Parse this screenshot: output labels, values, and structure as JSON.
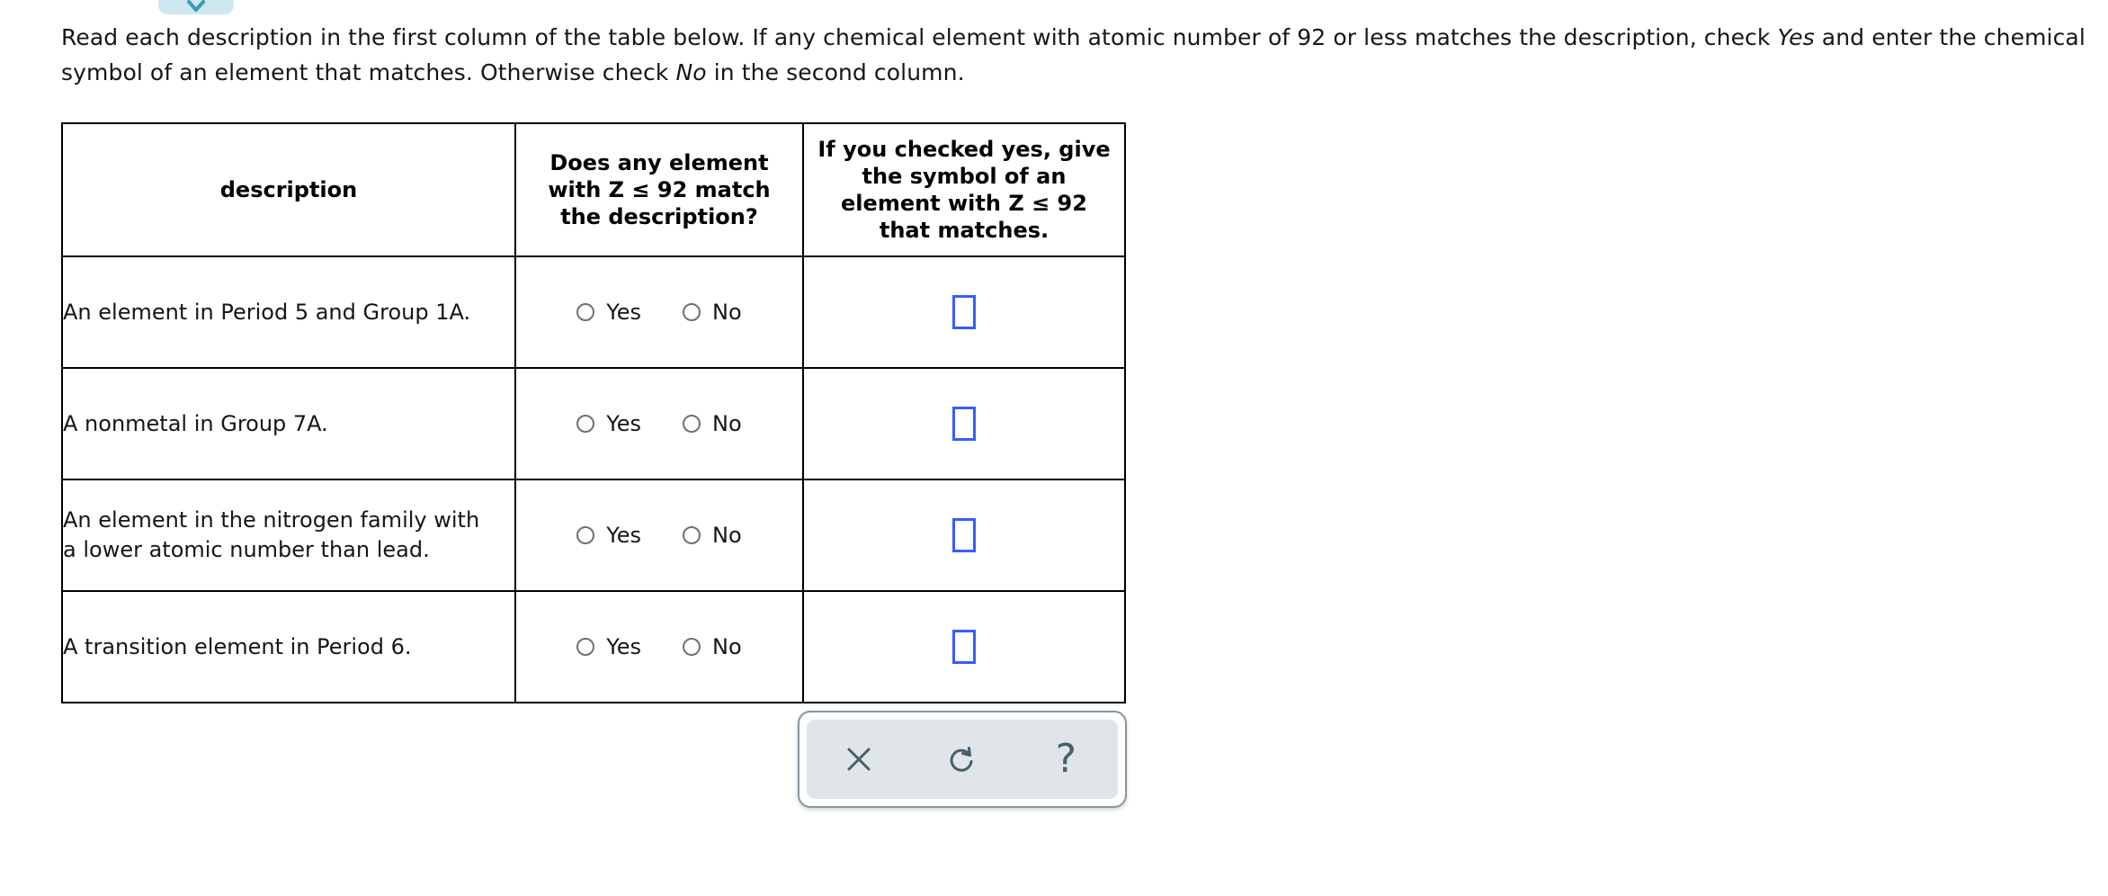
{
  "badge": {
    "icon": "chevron-down-icon",
    "glyph": "▼",
    "background_color": "#cfe8ef",
    "icon_color": "#3a9cb5"
  },
  "instructions": {
    "part1": "Read each description in the first column of the table below. If any chemical element with atomic number of 92 or less matches the description, check ",
    "emphasis1": "Yes",
    "part2": " and enter the chemical symbol of an element that matches. Otherwise check ",
    "emphasis2": "No",
    "part3": " in the second column."
  },
  "table": {
    "headers": [
      "description",
      "Does any element with Z ≤ 92 match the description?",
      "If you checked yes, give the symbol of an element with Z ≤ 92 that matches."
    ],
    "header_lines": {
      "col1": [
        "description"
      ],
      "col2": [
        "Does any element",
        "with Z ≤ 92 match",
        "the description?"
      ],
      "col3": [
        "If you checked yes, give",
        "the symbol of an",
        "element with Z ≤ 92",
        "that matches."
      ]
    },
    "radio_options": {
      "yes_label": "Yes",
      "no_label": "No"
    },
    "symbol_input": {
      "value": "",
      "placeholder": "",
      "border_color": "#3b5bfd"
    },
    "rows": [
      {
        "description": "An element in Period 5 and Group 1A.",
        "selected": "",
        "symbol": ""
      },
      {
        "description": "A nonmetal in Group 7A.",
        "selected": "",
        "symbol": ""
      },
      {
        "description": "An element in the nitrogen family with a lower atomic number than lead.",
        "description_lines": [
          "An element in the nitrogen family with",
          "a lower atomic number than lead."
        ],
        "selected": "",
        "symbol": ""
      },
      {
        "description": "A transition element in Period 6.",
        "selected": "",
        "symbol": ""
      }
    ]
  },
  "toolbar": {
    "buttons": [
      {
        "name": "close-icon",
        "label": "×",
        "title": "Clear"
      },
      {
        "name": "undo-refresh-icon",
        "label": "↺",
        "title": "Reset"
      },
      {
        "name": "help-icon",
        "label": "?",
        "title": "Help"
      }
    ],
    "help_glyph": "?",
    "panel_color": "#dfe5e8",
    "icon_color": "#44606e",
    "border_color": "#8397a3"
  }
}
